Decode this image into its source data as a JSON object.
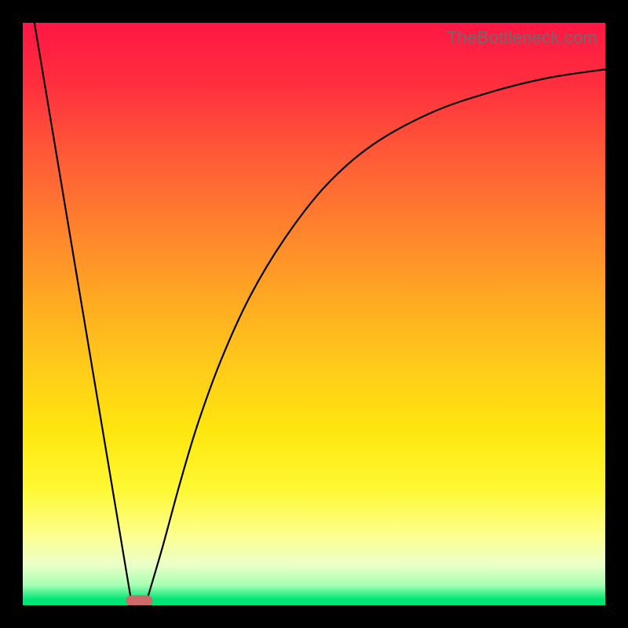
{
  "watermark": "TheBottleneck.com",
  "chart_data": {
    "type": "line",
    "title": "",
    "xlabel": "",
    "ylabel": "",
    "xlim": [
      0,
      1
    ],
    "ylim": [
      0,
      1
    ],
    "background": "gradient-red-yellow-green-vertical",
    "series": [
      {
        "name": "left-branch",
        "x": [
          0.02,
          0.185
        ],
        "values": [
          1.0,
          0.015
        ]
      },
      {
        "name": "right-branch",
        "x": [
          0.215,
          0.24,
          0.27,
          0.3,
          0.34,
          0.39,
          0.45,
          0.52,
          0.6,
          0.7,
          0.8,
          0.9,
          1.0
        ],
        "values": [
          0.015,
          0.1,
          0.21,
          0.31,
          0.42,
          0.53,
          0.63,
          0.72,
          0.79,
          0.845,
          0.88,
          0.905,
          0.92
        ]
      }
    ],
    "marker": {
      "name": "bottleneck-point",
      "x": 0.2,
      "y": 0.008,
      "shape": "rounded-pill",
      "color": "#cf6a6a"
    }
  }
}
